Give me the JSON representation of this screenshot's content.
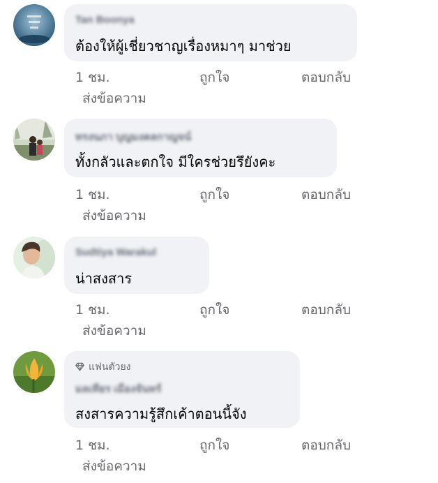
{
  "comments": [
    {
      "author": "Tan Boonya",
      "text": "ต้องให้ผู้เชี่ยวชาญเรื่องหมาๆ มาช่วย",
      "actions": {
        "time": "1 ชม.",
        "like": "ถูกใจ",
        "reply": "ตอบกลับ",
        "message": "ส่งข้อความ"
      }
    },
    {
      "author": "ทรงนภา บุญมงคลกาญจน์",
      "text": "ทั้งกลัวและตกใจ มีใครช่วยรึยังคะ",
      "actions": {
        "time": "1 ชม.",
        "like": "ถูกใจ",
        "reply": "ตอบกลับ",
        "message": "ส่งข้อความ"
      }
    },
    {
      "author": "Sudtiya Warakul",
      "text": "น่าสงสาร",
      "actions": {
        "time": "1 ชม.",
        "like": "ถูกใจ",
        "reply": "ตอบกลับ",
        "message": "ส่งข้อความ"
      }
    },
    {
      "badge": "แฟนตัวยง",
      "author": "มลเทียร เมืองจันทร์",
      "text": "สงสารความรู้สึกเค้าตอนนี้จัง",
      "actions": {
        "time": "1 ชม.",
        "like": "ถูกใจ",
        "reply": "ตอบกลับ",
        "message": "ส่งข้อความ"
      }
    }
  ]
}
